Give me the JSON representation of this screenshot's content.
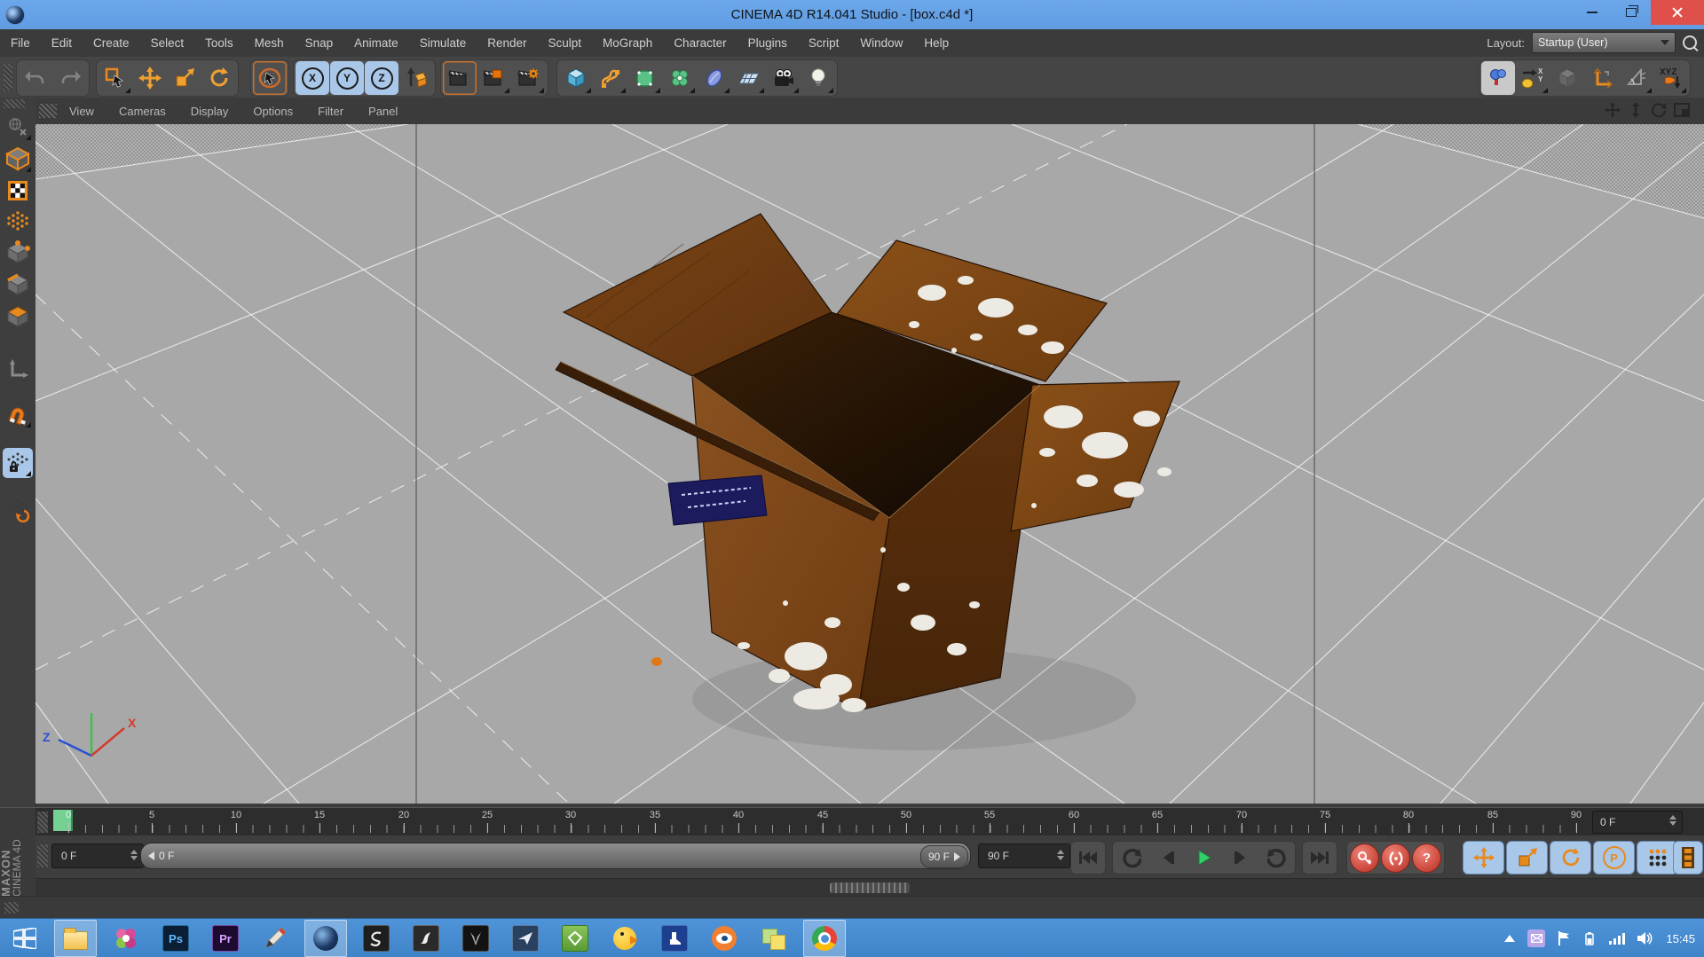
{
  "window_title": "CINEMA 4D R14.041 Studio - [box.c4d *]",
  "menu_bar": {
    "items": [
      "File",
      "Edit",
      "Create",
      "Select",
      "Tools",
      "Mesh",
      "Snap",
      "Animate",
      "Simulate",
      "Render",
      "Sculpt",
      "MoGraph",
      "Character",
      "Plugins",
      "Script",
      "Window",
      "Help"
    ],
    "layout_label": "Layout:",
    "layout_value": "Startup (User)"
  },
  "toolbar": {
    "axis_x": "X",
    "axis_y": "Y",
    "axis_z": "Z",
    "xyz_label": "XYZ"
  },
  "viewport": {
    "menu": [
      "View",
      "Cameras",
      "Display",
      "Options",
      "Filter",
      "Panel"
    ],
    "gizmo_x": "X",
    "gizmo_z": "Z"
  },
  "timeline": {
    "labels": [
      "0",
      "5",
      "10",
      "15",
      "20",
      "25",
      "30",
      "35",
      "40",
      "45",
      "50",
      "55",
      "60",
      "65",
      "70",
      "75",
      "80",
      "85",
      "90"
    ],
    "current_frame": "0 F"
  },
  "transport": {
    "start": "0 F",
    "slider_start": "0 F",
    "slider_end": "90 F",
    "end": "90 F",
    "pla": "P"
  },
  "branding": {
    "maxon": "MAXON",
    "cinema": "CINEMA 4D"
  },
  "taskbar": {
    "ps": "Ps",
    "pr": "Pr",
    "clock": "15:45"
  },
  "colors": {
    "titlebar": "#64a2e8",
    "taskbar": "#4a90d8",
    "accent_orange": "#e8891d",
    "highlight_blue": "#a9c7e8",
    "close_red": "#e0504a",
    "marker_green": "#74d193"
  }
}
